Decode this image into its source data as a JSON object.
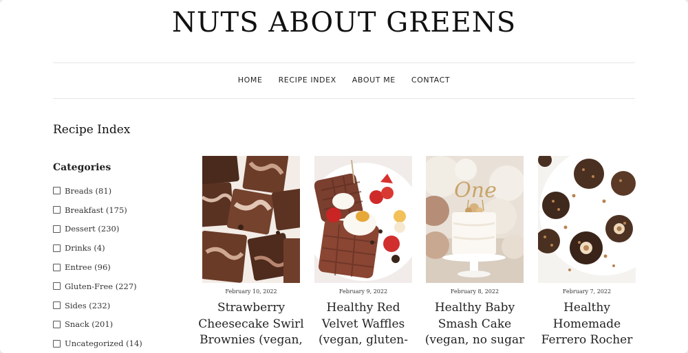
{
  "site": {
    "title": "NUTS ABOUT GREENS"
  },
  "nav": {
    "items": [
      "HOME",
      "RECIPE INDEX",
      "ABOUT ME",
      "CONTACT"
    ]
  },
  "sidebar": {
    "title": "Recipe Index",
    "categories_heading": "Categories",
    "categories": [
      "Breads (81)",
      "Breakfast (175)",
      "Dessert (230)",
      "Drinks (4)",
      "Entree (96)",
      "Gluten-Free (227)",
      "Sides (232)",
      "Snack (201)",
      "Uncategorized (14)"
    ]
  },
  "recipes": [
    {
      "date": "February 10, 2022",
      "title": "Strawberry Cheesecake Swirl Brownies (vegan,",
      "image": "brownies-photo"
    },
    {
      "date": "February 9, 2022",
      "title": "Healthy Red Velvet Waffles (vegan, gluten-",
      "image": "waffles-photo"
    },
    {
      "date": "February 8, 2022",
      "title": "Healthy Baby Smash Cake (vegan, no sugar",
      "image": "smash-cake-photo",
      "topper_text": "One"
    },
    {
      "date": "February 7, 2022",
      "title": "Healthy Homemade Ferrero Rocher",
      "image": "ferrero-rocher-photo"
    }
  ]
}
